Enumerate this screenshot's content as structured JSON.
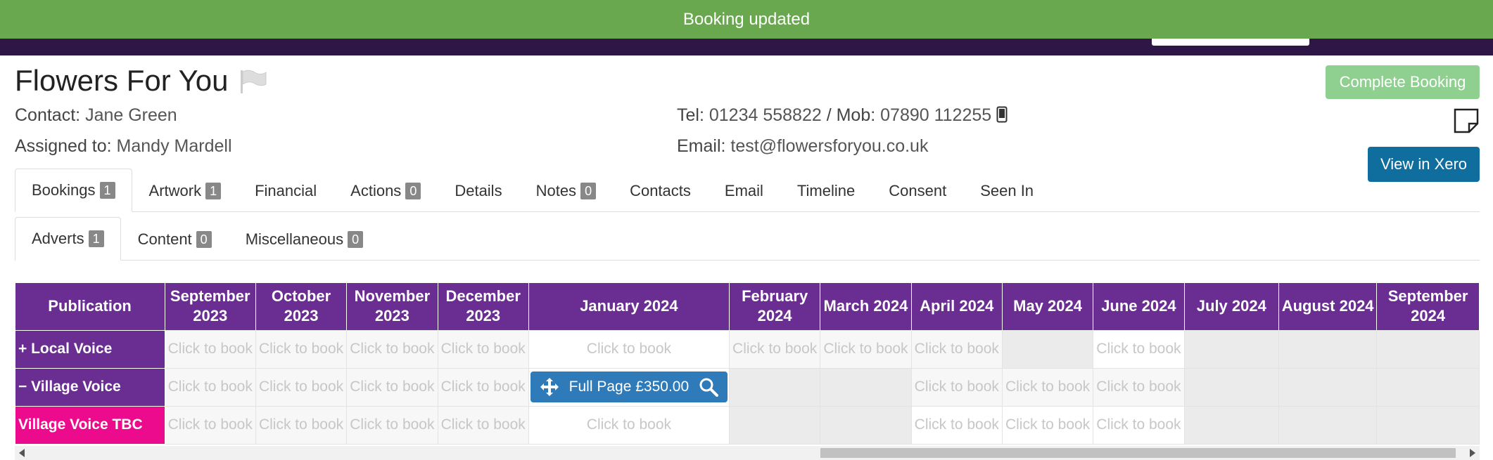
{
  "toast": {
    "message": "Booking updated",
    "color": "#6aa84f"
  },
  "company": {
    "name": "Flowers For You",
    "contact_label": "Contact:",
    "contact_name": "Jane Green",
    "assigned_label": "Assigned to:",
    "assigned_name": "Mandy Mardell",
    "tel_label": "Tel:",
    "tel": "01234 558822",
    "mob_label": "/ Mob:",
    "mob": "07890 112255",
    "email_label": "Email:",
    "email": "test@flowersforyou.co.uk"
  },
  "actions": {
    "complete_booking": "Complete Booking",
    "view_in_xero": "View in Xero"
  },
  "tabs": [
    {
      "label": "Bookings",
      "badge": "1"
    },
    {
      "label": "Artwork",
      "badge": "1"
    },
    {
      "label": "Financial",
      "badge": ""
    },
    {
      "label": "Actions",
      "badge": "0"
    },
    {
      "label": "Details",
      "badge": ""
    },
    {
      "label": "Notes",
      "badge": "0"
    },
    {
      "label": "Contacts",
      "badge": ""
    },
    {
      "label": "Email",
      "badge": ""
    },
    {
      "label": "Timeline",
      "badge": ""
    },
    {
      "label": "Consent",
      "badge": ""
    },
    {
      "label": "Seen In",
      "badge": ""
    }
  ],
  "subtabs": [
    {
      "label": "Adverts",
      "badge": "1"
    },
    {
      "label": "Content",
      "badge": "0"
    },
    {
      "label": "Miscellaneous",
      "badge": "0"
    }
  ],
  "grid": {
    "publication_header": "Publication",
    "months": [
      "September 2023",
      "October 2023",
      "November 2023",
      "December 2023",
      "January 2024",
      "February 2024",
      "March 2024",
      "April 2024",
      "May 2024",
      "June 2024",
      "July 2024",
      "August 2024",
      "September 2024"
    ],
    "click_label": "Click to book",
    "rows": [
      {
        "name": "+ Local Voice",
        "cells": [
          "book",
          "book",
          "book",
          "book",
          "bookfree",
          "book",
          "book",
          "book",
          "blocked",
          "bookfree",
          "blocked",
          "blocked",
          "blocked"
        ]
      },
      {
        "name": "− Village Voice",
        "cells": [
          "book",
          "book",
          "book",
          "book",
          "booked",
          "blocked",
          "blocked",
          "book",
          "book",
          "book",
          "blocked",
          "blocked",
          "blocked"
        ]
      },
      {
        "name": "Village Voice TBC",
        "tbc": true,
        "cells": [
          "book",
          "book",
          "book",
          "book",
          "bookfree",
          "blocked",
          "blocked",
          "bookfree",
          "bookfree",
          "bookfree",
          "blocked",
          "blocked",
          "blocked"
        ]
      }
    ],
    "booking": {
      "label": "Full Page £350.00"
    }
  },
  "colors": {
    "publication_purple": "#6a2d91",
    "tbc_pink": "#ec0b8c",
    "booking_blue": "#2f7ab8",
    "topbar": "#2e1646"
  }
}
